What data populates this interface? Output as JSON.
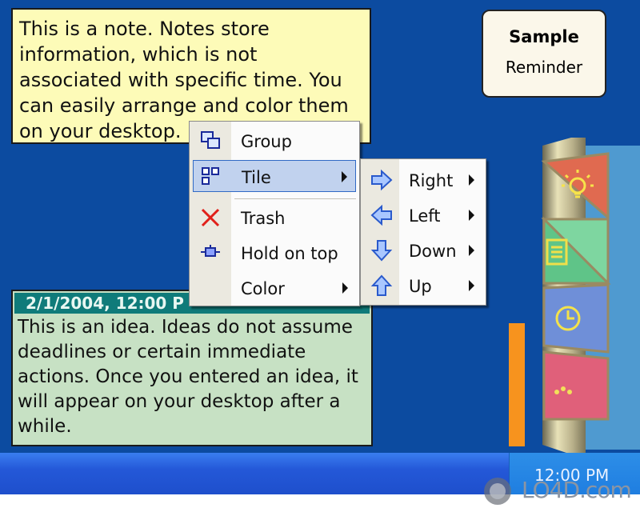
{
  "note": {
    "text": "This is a note. Notes store information, which is not associated with specific time. You can easily arrange and color them on your desktop."
  },
  "idea": {
    "timestamp": "2/1/2004, 12:00 P",
    "text": "This is an idea. Ideas do not assume deadlines or certain immediate actions. Once you entered an idea, it will appear on your desktop after a while."
  },
  "reminder": {
    "title": "Sample",
    "subtitle": "Reminder"
  },
  "context_menu": {
    "items": [
      {
        "label": "Group",
        "icon": "group-icon"
      },
      {
        "label": "Tile",
        "icon": "tile-icon",
        "submenu": true,
        "selected": true
      },
      {
        "label": "Trash",
        "icon": "trash-icon"
      },
      {
        "label": "Hold on top",
        "icon": "pin-icon"
      },
      {
        "label": "Color",
        "submenu": true
      }
    ]
  },
  "tile_submenu": {
    "items": [
      {
        "label": "Right",
        "icon": "arrow-right-icon"
      },
      {
        "label": "Left",
        "icon": "arrow-left-icon"
      },
      {
        "label": "Down",
        "icon": "arrow-down-icon"
      },
      {
        "label": "Up",
        "icon": "arrow-up-icon"
      }
    ]
  },
  "sidebar": {
    "buttons": [
      "lightbulb-icon",
      "note-icon",
      "clock-icon",
      "more-icon"
    ]
  },
  "taskbar": {
    "clock": "12:00 PM"
  },
  "watermark": {
    "text": "LO4D.com"
  },
  "colors": {
    "desktop": "#0c4ba0",
    "note": "#fdfbb8",
    "idea": "#c7e1c4",
    "idea_header": "#0f7b7a",
    "menu_selected": "#c1d2ee"
  }
}
